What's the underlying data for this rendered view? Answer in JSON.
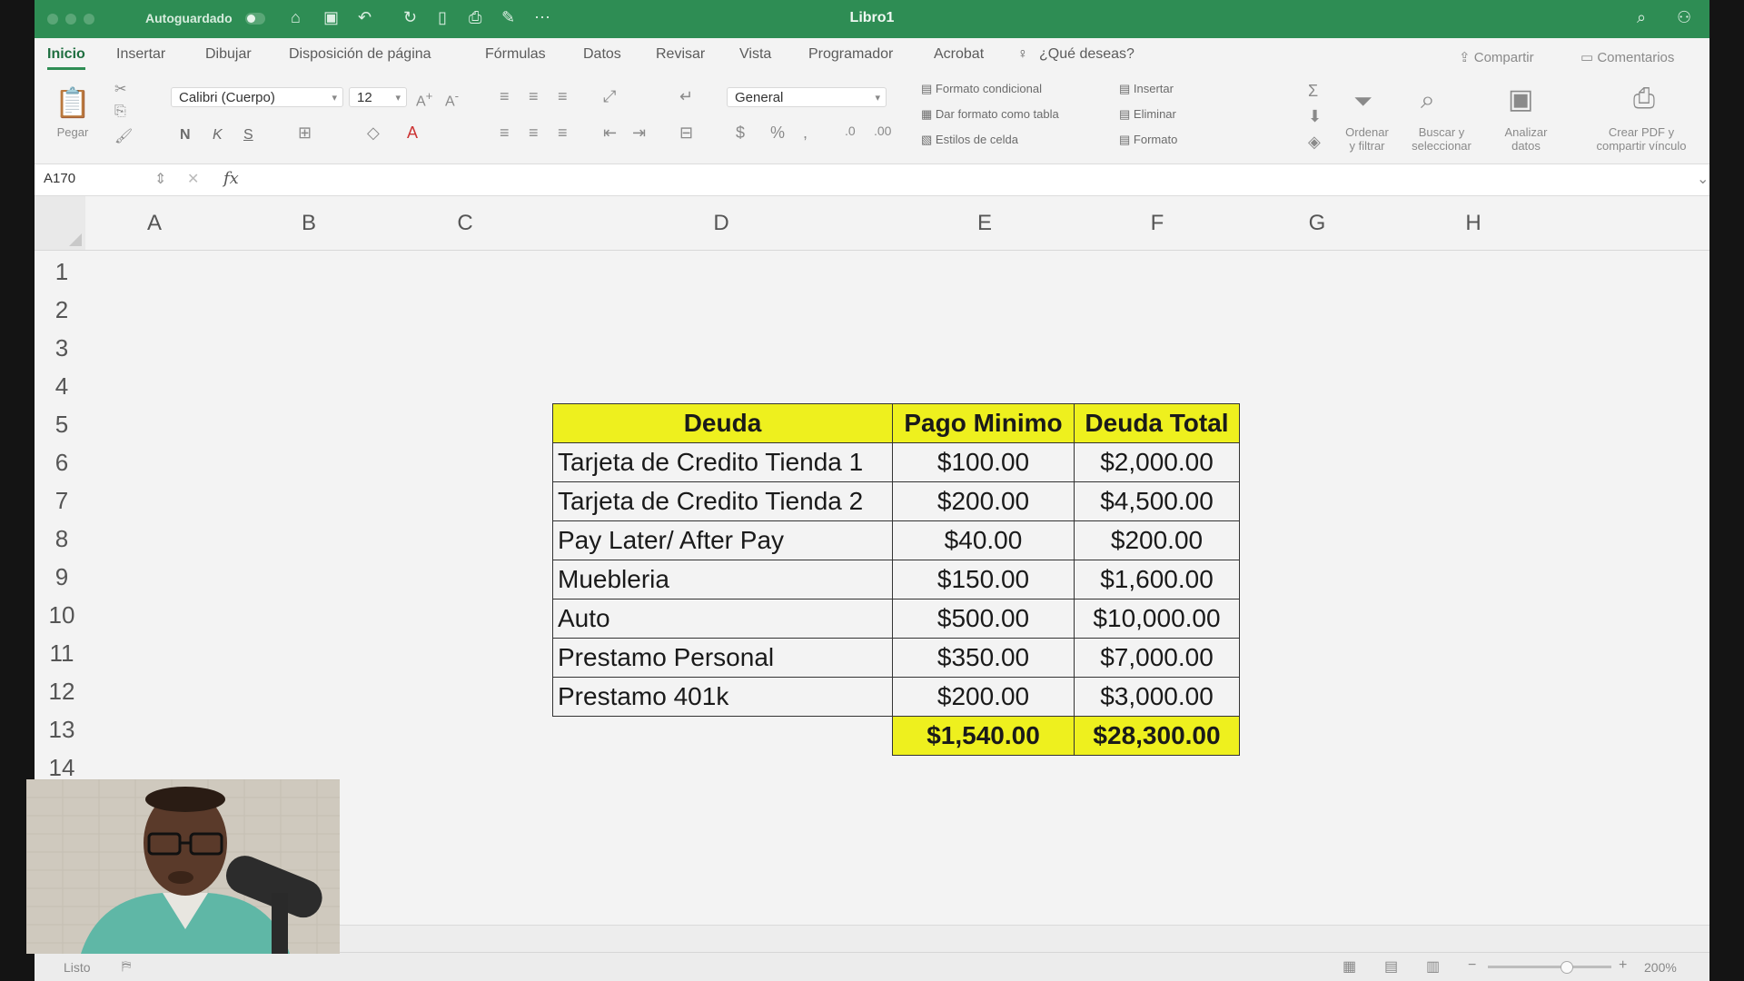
{
  "titlebar": {
    "autosave": "Autoguardado",
    "title": "Libro1"
  },
  "tabs": [
    {
      "label": "Inicio"
    },
    {
      "label": "Insertar"
    },
    {
      "label": "Dibujar"
    },
    {
      "label": "Disposición de página"
    },
    {
      "label": "Fórmulas"
    },
    {
      "label": "Datos"
    },
    {
      "label": "Revisar"
    },
    {
      "label": "Vista"
    },
    {
      "label": "Programador"
    },
    {
      "label": "Acrobat"
    },
    {
      "label": "¿Qué deseas?"
    }
  ],
  "share": {
    "compartir": "Compartir",
    "comentarios": "Comentarios"
  },
  "ribbon": {
    "paste": "Pegar",
    "font_name": "Calibri (Cuerpo)",
    "font_size": "12",
    "bold": "N",
    "italic": "K",
    "underline": "S",
    "number_format": "General",
    "conditional_format": "Formato condicional",
    "format_as_table": "Dar formato como tabla",
    "cell_styles": "Estilos de celda",
    "insert": "Insertar",
    "delete": "Eliminar",
    "format": "Formato",
    "sort_filter_1": "Ordenar",
    "sort_filter_2": "y filtrar",
    "find_select_1": "Buscar y",
    "find_select_2": "seleccionar",
    "analyze_1": "Analizar",
    "analyze_2": "datos",
    "pdf_1": "Crear PDF y",
    "pdf_2": "compartir vínculo"
  },
  "formula_bar": {
    "cell_ref": "A170",
    "fx": "fx"
  },
  "columns": [
    "A",
    "B",
    "C",
    "D",
    "E",
    "F",
    "G",
    "H"
  ],
  "rows": [
    "1",
    "2",
    "3",
    "4",
    "5",
    "6",
    "7",
    "8",
    "9",
    "10",
    "11",
    "12",
    "13",
    "14"
  ],
  "table": {
    "headers": [
      "Deuda",
      "Pago Minimo",
      "Deuda Total"
    ],
    "rows": [
      [
        "Tarjeta de Credito Tienda 1",
        "$100.00",
        "$2,000.00"
      ],
      [
        "Tarjeta de Credito Tienda 2",
        "$200.00",
        "$4,500.00"
      ],
      [
        "Pay Later/ After Pay",
        "$40.00",
        "$200.00"
      ],
      [
        "Muebleria",
        "$150.00",
        "$1,600.00"
      ],
      [
        "Auto",
        "$500.00",
        "$10,000.00"
      ],
      [
        "Prestamo Personal",
        "$350.00",
        "$7,000.00"
      ],
      [
        "Prestamo 401k",
        "$200.00",
        "$3,000.00"
      ]
    ],
    "totals": [
      "$1,540.00",
      "$28,300.00"
    ]
  },
  "status": {
    "state": "Listo",
    "zoom": "200%"
  },
  "colors": {
    "title_green": "#2e8d54",
    "header_yellow": "#eef01e"
  }
}
